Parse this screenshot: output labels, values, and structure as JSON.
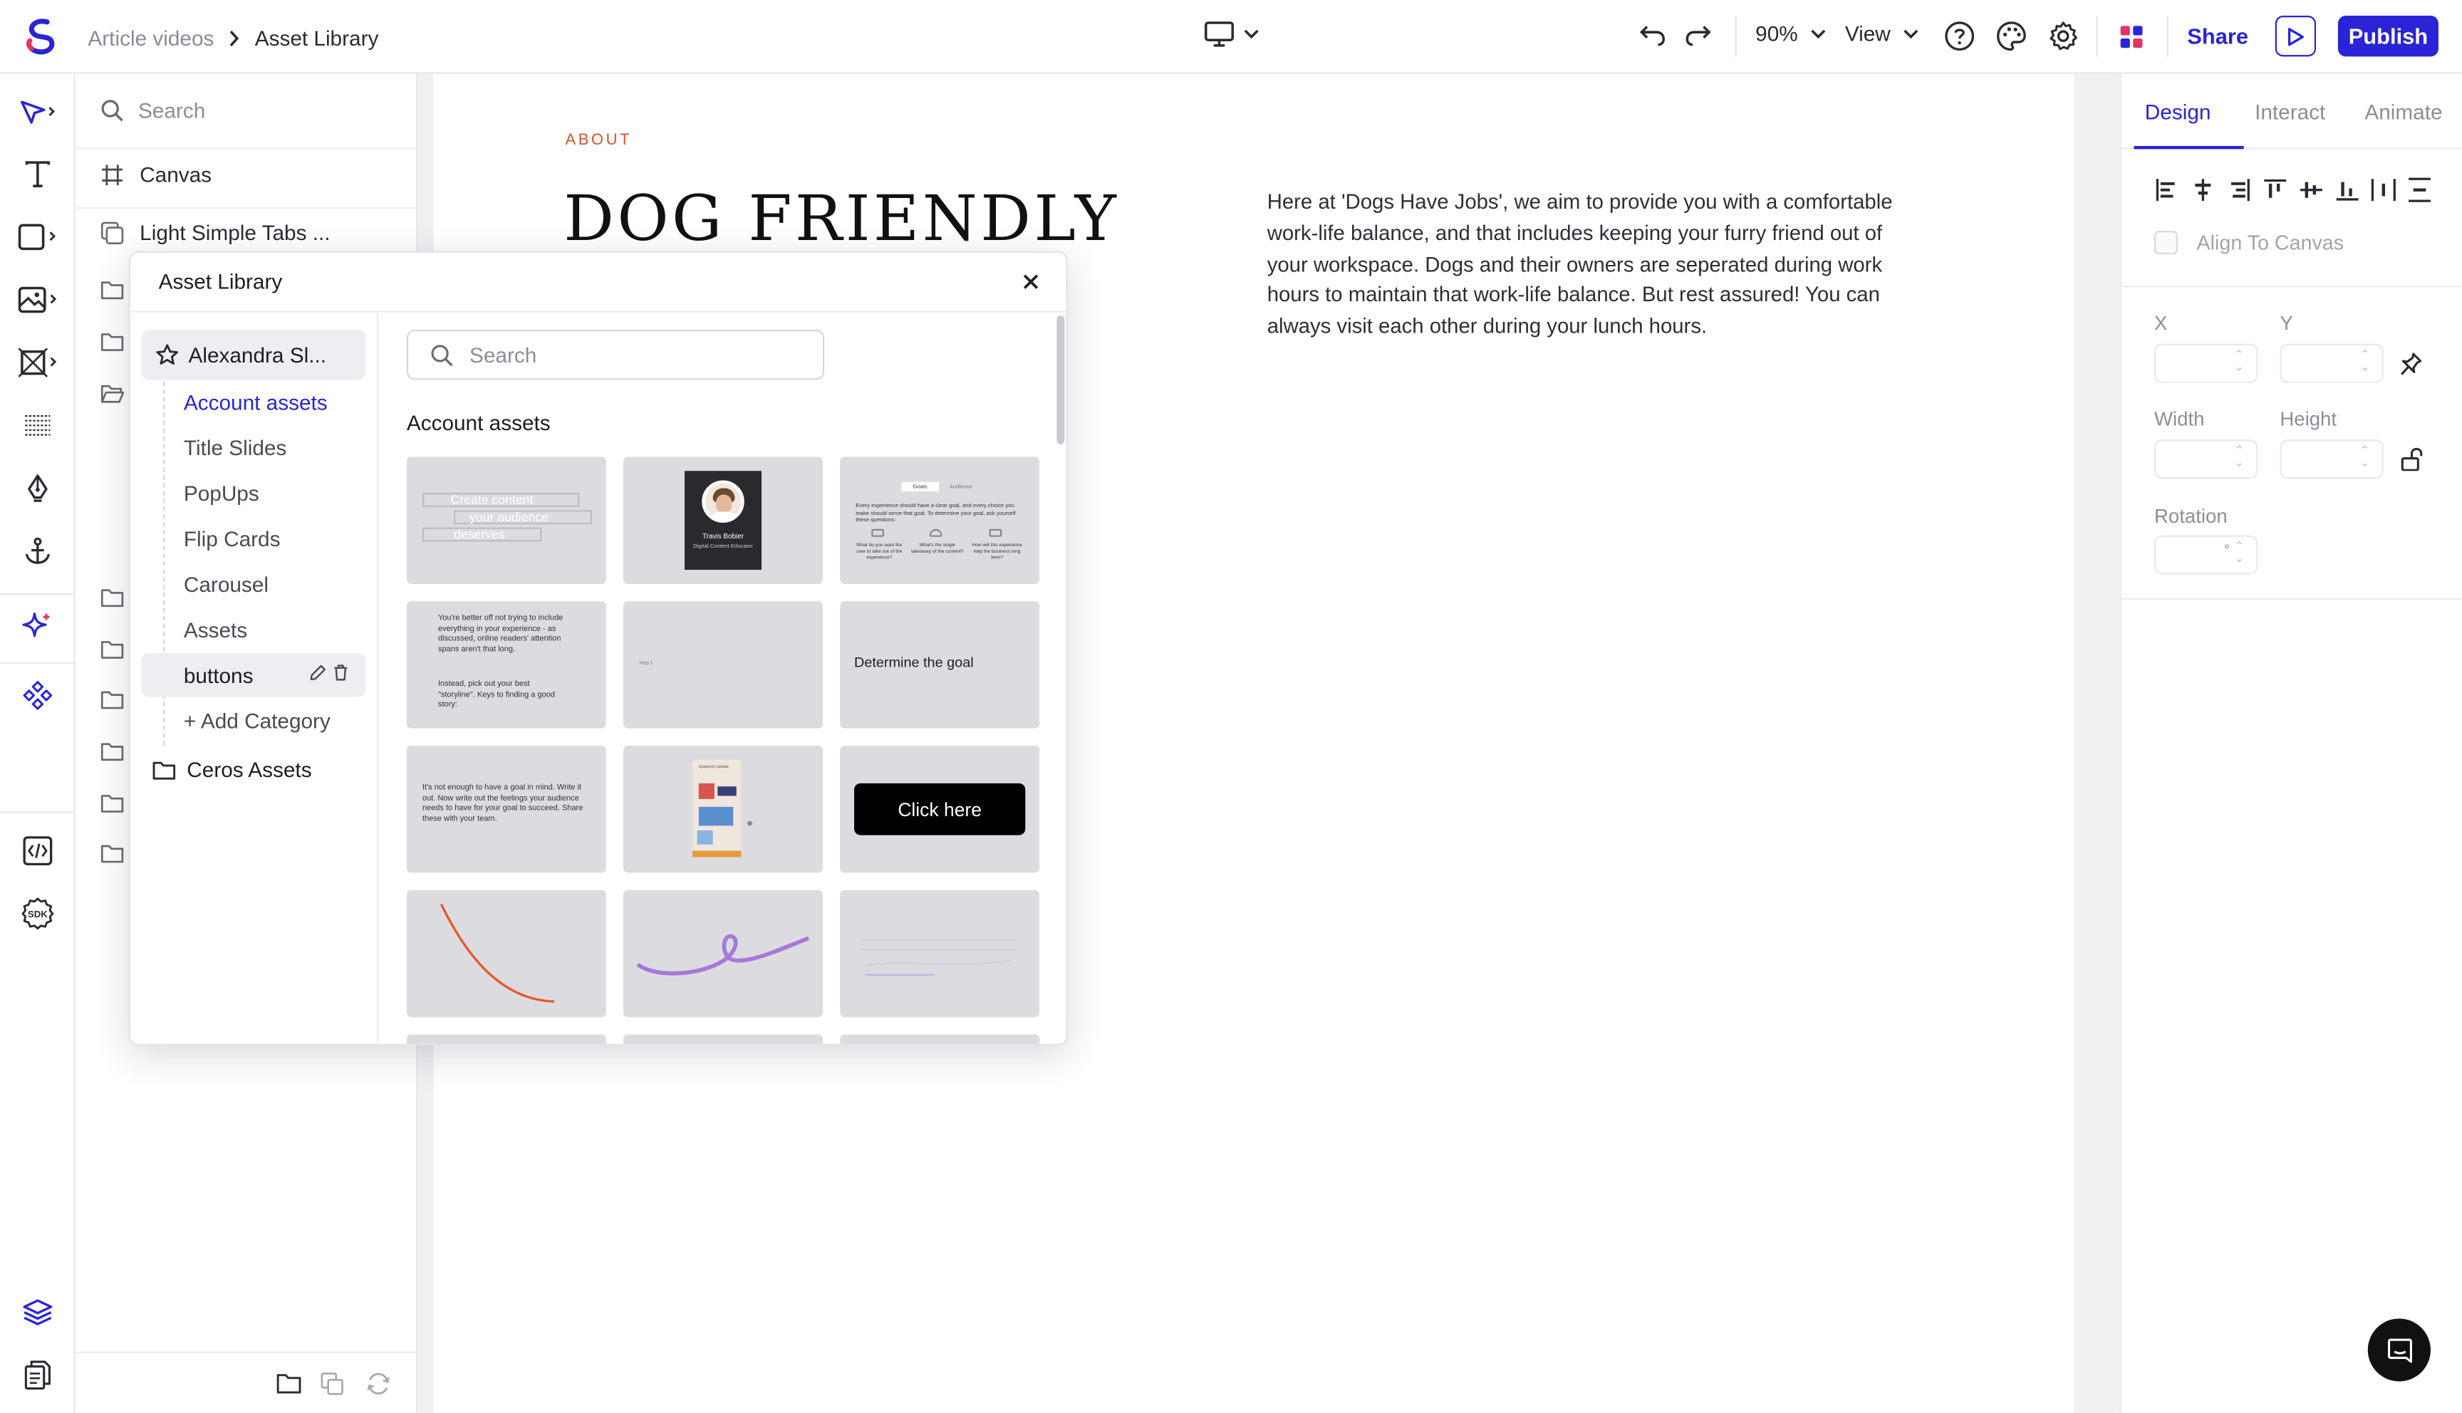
{
  "topbar": {
    "breadcrumb_parent": "Article videos",
    "breadcrumb_sep": ">",
    "breadcrumb_current": "Asset Library",
    "zoom": "90%",
    "view_label": "View",
    "share_label": "Share",
    "publish_label": "Publish"
  },
  "layers": {
    "search_placeholder": "Search",
    "canvas_label": "Canvas",
    "first_layer": "Light Simple Tabs ..."
  },
  "artboard": {
    "eyebrow": "ABOUT",
    "heading": "DOG FRIENDLY",
    "body": "Here at 'Dogs Have Jobs', we aim to provide you with a comfortable work-life balance, and that includes keeping your furry friend out of your workspace. Dogs and their owners are seperated during work hours to maintain that work-life balance. But rest assured! You can always visit each other during your lunch hours."
  },
  "rightpanel": {
    "tabs": [
      "Design",
      "Interact",
      "Animate"
    ],
    "align_to_canvas": "Align To Canvas",
    "x_label": "X",
    "y_label": "Y",
    "width_label": "Width",
    "height_label": "Height",
    "rotation_label": "Rotation",
    "rotation_unit": "°"
  },
  "modal": {
    "title": "Asset Library",
    "owner": "Alexandra Sl...",
    "categories": [
      "Account assets",
      "Title Slides",
      "PopUps",
      "Flip Cards",
      "Carousel",
      "Assets",
      "buttons"
    ],
    "add_category": "+ Add Category",
    "ceros_assets": "Ceros Assets",
    "search_placeholder": "Search",
    "section_title": "Account assets",
    "thumbs": {
      "t1_line1": "Create content",
      "t1_line2": "your audience",
      "t1_line3": "deserves",
      "t2_name": "Travis Bobier",
      "t2_role": "Digital Content Educator",
      "t3_tab1": "Goals",
      "t3_tab2": "Audience",
      "t3_body": "Every experience should have a clear goal, and every choice you make should serve that goal. To determine your goal, ask yourself these questions:",
      "t3_c1": "What do you want the user to take out of the experience?",
      "t3_c2": "What's the single takeaway of the content?",
      "t3_c3": "How will this experience help the business long term?",
      "t4_p1": "You're better off not trying to include everything in your experience - as discussed, online readers' attention spans aren't that long.",
      "t4_p2": "Instead, pick out your best \"storyline\". Keys to finding a good story:",
      "t5_text": "Step 1",
      "t6_text": "Determine the goal",
      "t7_text": "It's not enough to have a goal in mind. Write it out. Now write out the feelings your audience needs to have for your goal to succeed. Share these with your team.",
      "t8_label": "Quarterly Update",
      "t9_button": "Click here"
    }
  },
  "colors": {
    "accent": "#2a24d6",
    "eyebrow": "#d1552c",
    "curve_orange": "#e8582a",
    "curve_purple": "#a57ad9"
  }
}
